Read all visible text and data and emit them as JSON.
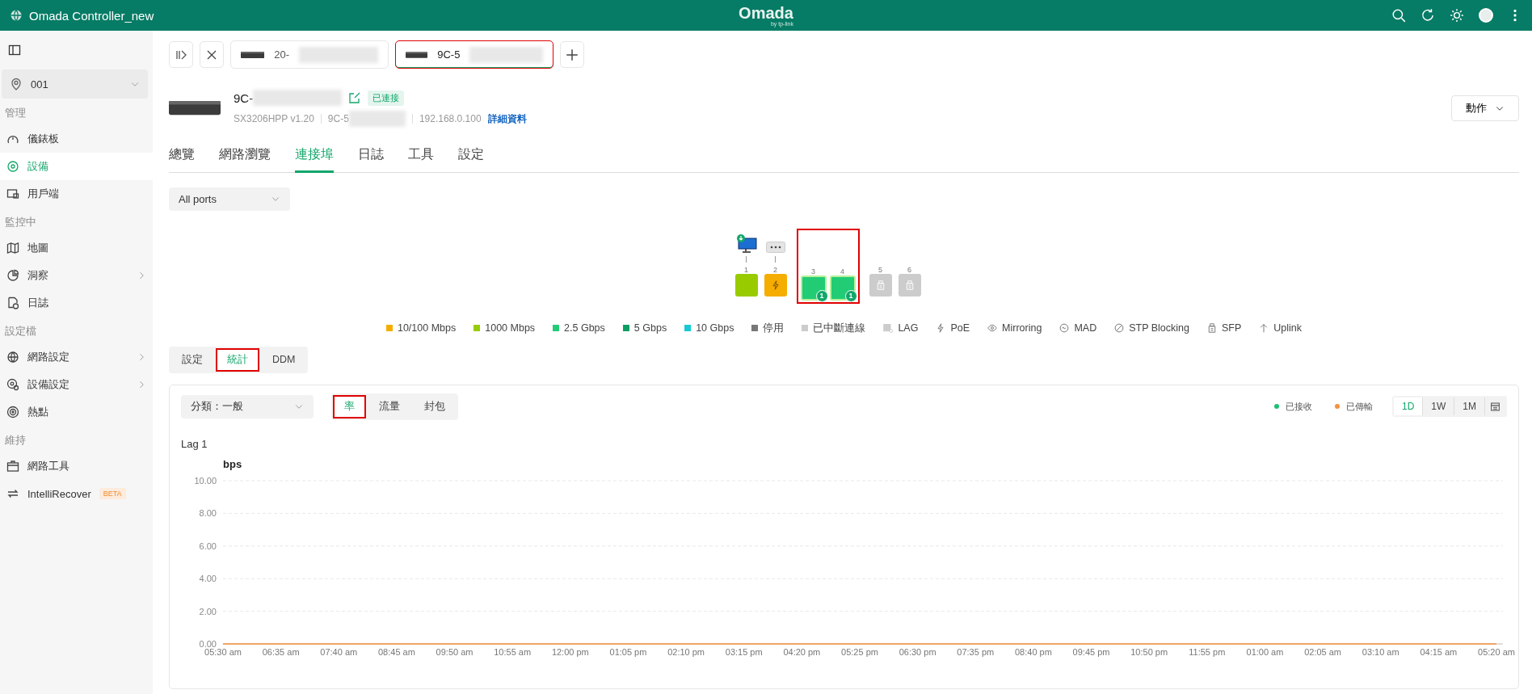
{
  "topbar": {
    "title": "Omada Controller_new",
    "logo": "Omada",
    "logo_sub": "by tp-link"
  },
  "sidebar": {
    "site": "001",
    "groups": [
      {
        "title": "管理",
        "items": [
          {
            "kind": "dashboard",
            "label": "儀錶板",
            "selected": false,
            "expandable": false
          },
          {
            "kind": "device",
            "label": "設備",
            "selected": true,
            "expandable": false
          },
          {
            "kind": "client",
            "label": "用戶端",
            "selected": false,
            "expandable": false
          }
        ]
      },
      {
        "title": "監控中",
        "items": [
          {
            "kind": "map",
            "label": "地圖",
            "selected": false,
            "expandable": false
          },
          {
            "kind": "insight",
            "label": "洞察",
            "selected": false,
            "expandable": true
          },
          {
            "kind": "log",
            "label": "日誌",
            "selected": false,
            "expandable": false
          }
        ]
      },
      {
        "title": "設定檔",
        "items": [
          {
            "kind": "network",
            "label": "網路設定",
            "selected": false,
            "expandable": true
          },
          {
            "kind": "devconf",
            "label": "設備設定",
            "selected": false,
            "expandable": true
          },
          {
            "kind": "hotspot",
            "label": "熱點",
            "selected": false,
            "expandable": false
          }
        ]
      },
      {
        "title": "維持",
        "items": [
          {
            "kind": "tools",
            "label": "網路工具",
            "selected": false,
            "expandable": false
          },
          {
            "kind": "recover",
            "label": "IntelliRecover",
            "selected": false,
            "expandable": false,
            "badge": "BETA"
          }
        ]
      }
    ]
  },
  "device_tabs": [
    {
      "label": "20-",
      "selected": false,
      "highlighted": false
    },
    {
      "label": "9C-5",
      "selected": true,
      "highlighted": true
    }
  ],
  "device": {
    "name": "9C-",
    "status": "已連接",
    "model": "SX3206HPP v1.20",
    "mac": "9C-5",
    "ip": "192.168.0.100",
    "details_link": "詳細資料",
    "action_button": "動作"
  },
  "nav_tabs": [
    {
      "label": "總覽",
      "selected": false
    },
    {
      "label": "網路瀏覽",
      "selected": false
    },
    {
      "label": "連接埠",
      "selected": true
    },
    {
      "label": "日誌",
      "selected": false
    },
    {
      "label": "工具",
      "selected": false
    },
    {
      "label": "設定",
      "selected": false
    }
  ],
  "port_filter": {
    "value": "All ports"
  },
  "port_groups": [
    {
      "highlighted": false,
      "ports": [
        {
          "number": "1",
          "kind": "copper",
          "color": "#99cc00",
          "poe": false,
          "attached": {
            "kind": "pc"
          }
        },
        {
          "number": "2",
          "kind": "copper",
          "color": "#f5ad00",
          "poe": true,
          "attached": {
            "kind": "unknown"
          }
        }
      ]
    },
    {
      "highlighted": true,
      "ports": [
        {
          "number": "3",
          "kind": "copper",
          "color": "#21cc75",
          "poe": false,
          "lag_badge": "1"
        },
        {
          "number": "4",
          "kind": "copper",
          "color": "#21cc75",
          "poe": false,
          "lag_badge": "1"
        }
      ]
    },
    {
      "highlighted": false,
      "ports": [
        {
          "number": "5",
          "kind": "sfp",
          "color": "#cccccc",
          "poe": false
        },
        {
          "number": "6",
          "kind": "sfp",
          "color": "#cccccc",
          "poe": false
        }
      ]
    }
  ],
  "legend": [
    {
      "kind": "swatch",
      "label": "10/100 Mbps",
      "color": "#f5ad00"
    },
    {
      "kind": "swatch",
      "label": "1000 Mbps",
      "color": "#99cc00"
    },
    {
      "kind": "swatch",
      "label": "2.5 Gbps",
      "color": "#21cc75"
    },
    {
      "kind": "swatch",
      "label": "5 Gbps",
      "color": "#0a9f63"
    },
    {
      "kind": "swatch",
      "label": "10 Gbps",
      "color": "#16c9d3"
    },
    {
      "kind": "swatch",
      "label": "停用",
      "color": "#777777"
    },
    {
      "kind": "swatch",
      "label": "已中斷連線",
      "color": "#cccccc"
    },
    {
      "kind": "lag",
      "label": "LAG"
    },
    {
      "kind": "poe",
      "label": "PoE"
    },
    {
      "kind": "mirror",
      "label": "Mirroring"
    },
    {
      "kind": "mad",
      "label": "MAD"
    },
    {
      "kind": "stp",
      "label": "STP Blocking"
    },
    {
      "kind": "sfp",
      "label": "SFP"
    },
    {
      "kind": "uplink",
      "label": "Uplink"
    }
  ],
  "sub_tabs": [
    {
      "label": "設定",
      "selected": false,
      "highlighted": false
    },
    {
      "label": "統計",
      "selected": true,
      "highlighted": true
    },
    {
      "label": "DDM",
      "selected": false,
      "highlighted": false
    }
  ],
  "stats": {
    "category": "分類：一般",
    "metric_tabs": [
      {
        "label": "率",
        "selected": true,
        "highlighted": true
      },
      {
        "label": "流量",
        "selected": false,
        "highlighted": false
      },
      {
        "label": "封包",
        "selected": false,
        "highlighted": false
      }
    ],
    "ranges": [
      {
        "label": "1D",
        "selected": true
      },
      {
        "label": "1W",
        "selected": false
      },
      {
        "label": "1M",
        "selected": false
      }
    ],
    "chart_data": {
      "type": "line",
      "title": "Lag 1",
      "ylabel": "bps",
      "categories": [
        "05:30 am",
        "06:35 am",
        "07:40 am",
        "08:45 am",
        "09:50 am",
        "10:55 am",
        "12:00 pm",
        "01:05 pm",
        "02:10 pm",
        "03:15 pm",
        "04:20 pm",
        "05:25 pm",
        "06:30 pm",
        "07:35 pm",
        "08:40 pm",
        "09:45 pm",
        "10:50 pm",
        "11:55 pm",
        "01:00 am",
        "02:05 am",
        "03:10 am",
        "04:15 am",
        "05:20 am"
      ],
      "grid": true,
      "series": [
        {
          "name": "已接收",
          "color": "#1dbf73",
          "values": [
            null,
            null,
            null,
            null,
            null,
            null,
            null,
            null,
            null,
            null,
            null,
            null,
            null,
            null,
            null,
            null,
            null,
            null,
            null,
            null,
            null,
            null,
            null
          ]
        },
        {
          "name": "已傳輸",
          "color": "#f5923e",
          "values": [
            0,
            0,
            0,
            0,
            0,
            0,
            0,
            0,
            0,
            0,
            0,
            0,
            0,
            0,
            0,
            0,
            0,
            0,
            0,
            0,
            0,
            0,
            0
          ]
        }
      ],
      "ylim": [
        0,
        10
      ],
      "yticks": [
        {
          "value": 0,
          "label": "0.00"
        },
        {
          "value": 2,
          "label": "2.00"
        },
        {
          "value": 4,
          "label": "4.00"
        },
        {
          "value": 6,
          "label": "6.00"
        },
        {
          "value": 8,
          "label": "8.00"
        },
        {
          "value": 10,
          "label": "10.00"
        }
      ]
    }
  }
}
